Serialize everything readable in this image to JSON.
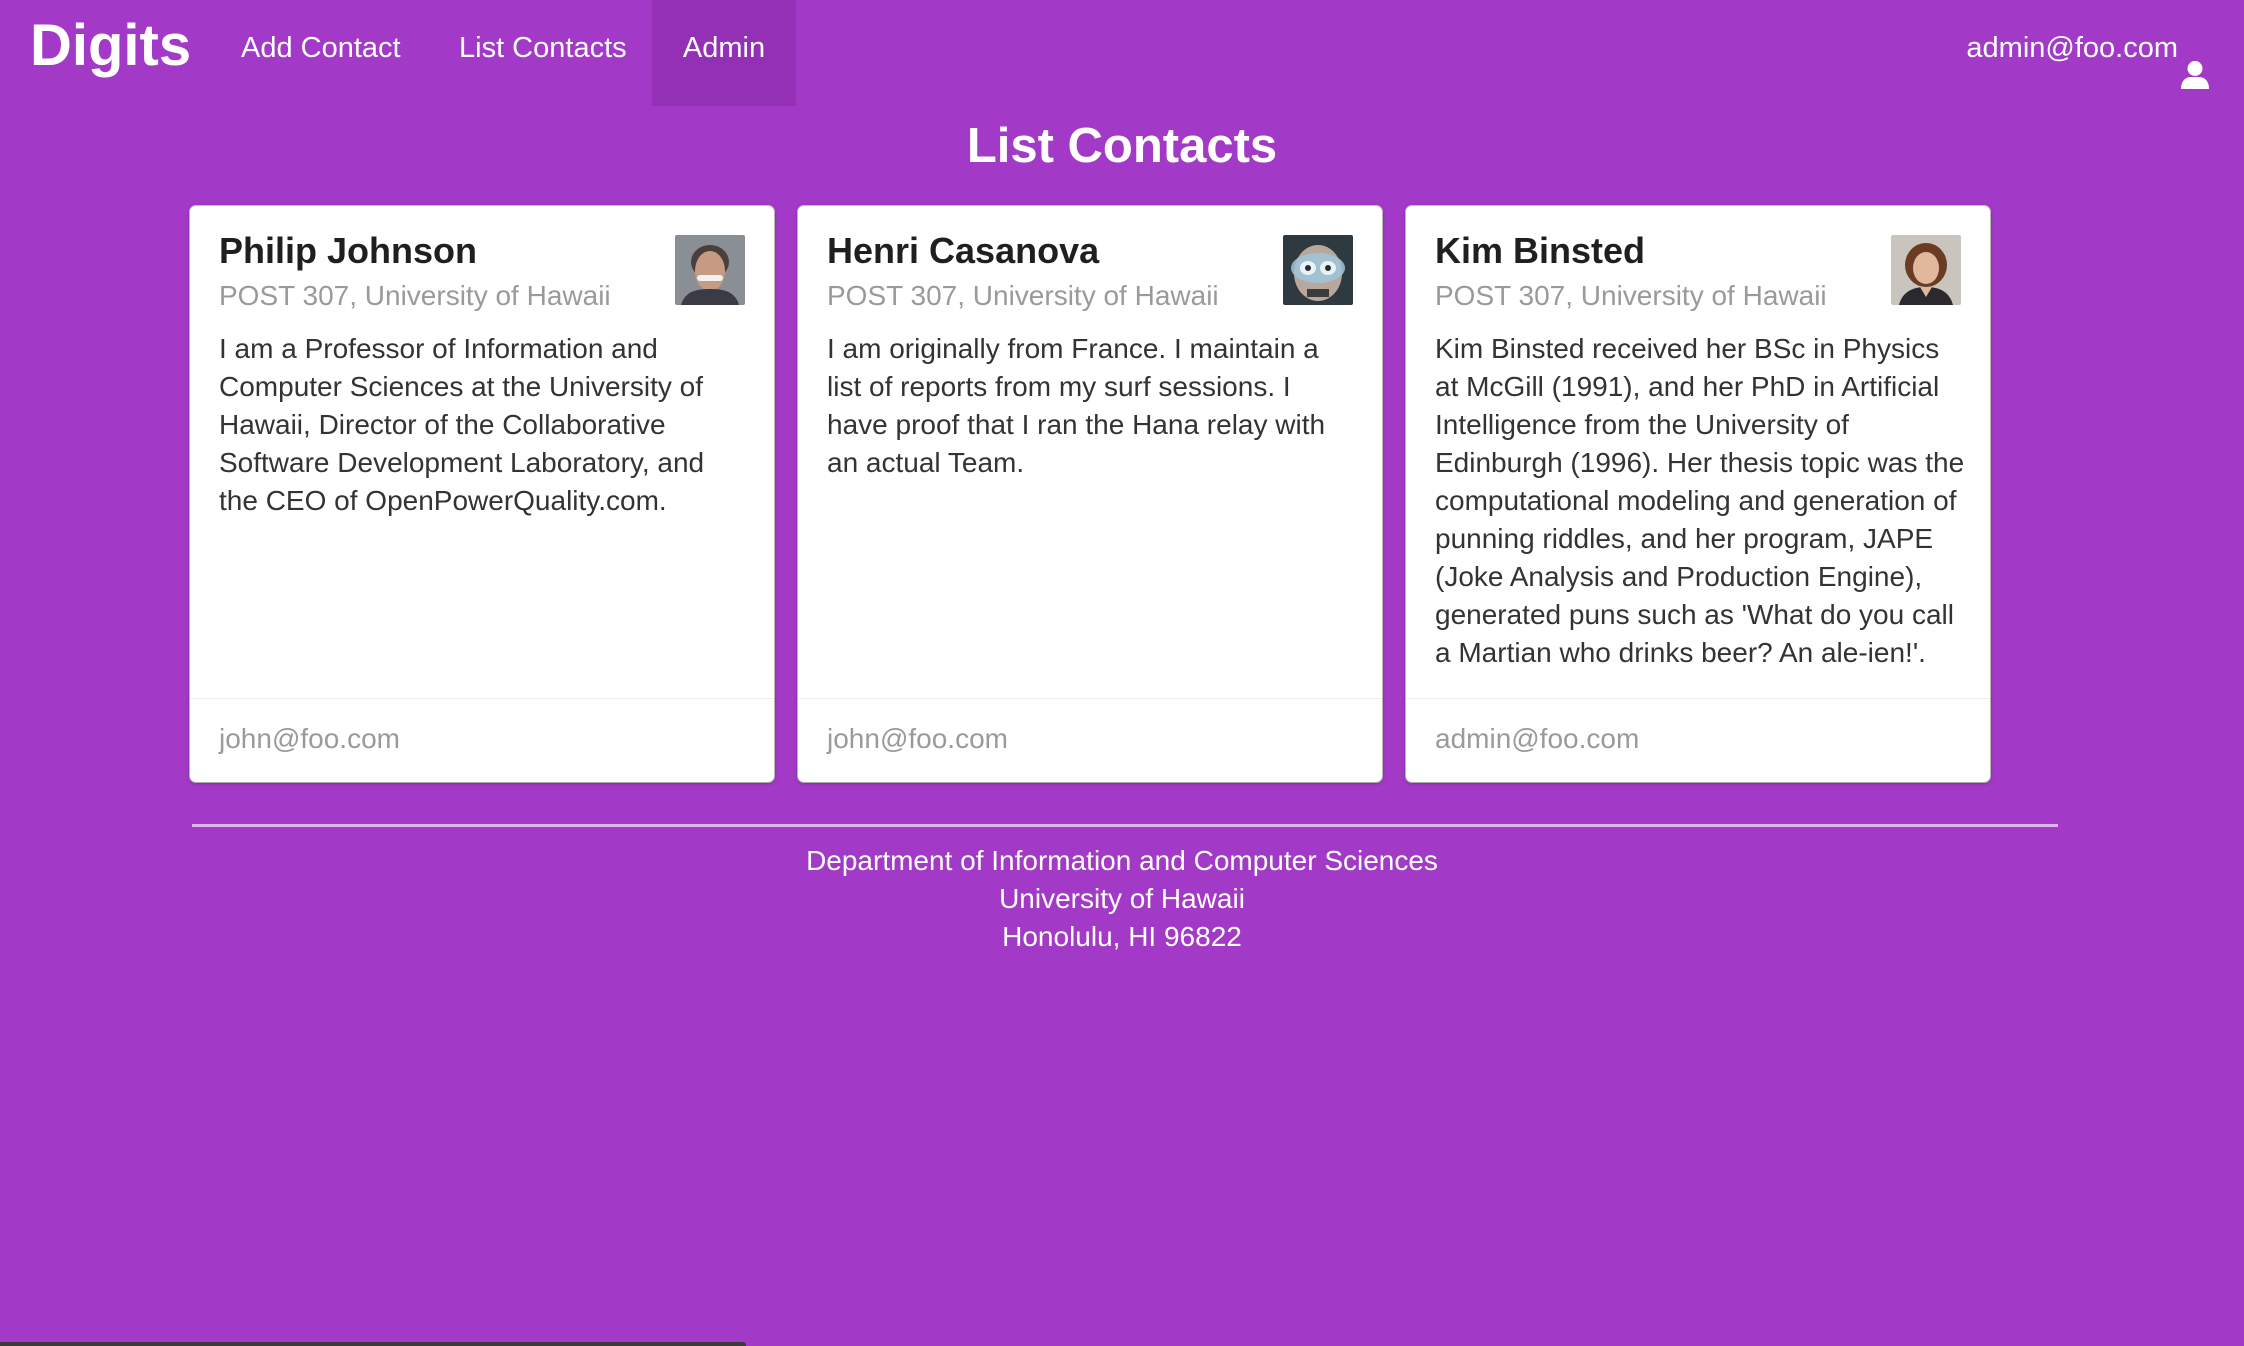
{
  "navbar": {
    "brand": "Digits",
    "links": {
      "add_contact": "Add Contact",
      "list_contacts": "List Contacts",
      "admin": "Admin"
    },
    "user_email": "admin@foo.com",
    "user_icon": "user-icon"
  },
  "page": {
    "title": "List Contacts"
  },
  "contacts": [
    {
      "name": "Philip Johnson",
      "address": "POST 307, University of Hawaii",
      "description": "I am a Professor of Information and Computer Sciences at the University of Hawaii, Director of the Collaborative Software Development Laboratory, and the CEO of OpenPowerQuality.com.",
      "owner": "john@foo.com"
    },
    {
      "name": "Henri Casanova",
      "address": "POST 307, University of Hawaii",
      "description": "I am originally from France. I maintain a list of reports from my surf sessions. I have proof that I ran the Hana relay with an actual Team.",
      "owner": "john@foo.com"
    },
    {
      "name": "Kim Binsted",
      "address": "POST 307, University of Hawaii",
      "description": "Kim Binsted received her BSc in Physics at McGill (1991), and her PhD in Artificial Intelligence from the University of Edinburgh (1996). Her thesis topic was the computational modeling and generation of punning riddles, and her program, JAPE (Joke Analysis and Production Engine), generated puns such as 'What do you call a Martian who drinks beer? An ale-ien!'.",
      "owner": "admin@foo.com"
    }
  ],
  "footer": {
    "line1": "Department of Information and Computer Sciences",
    "line2": "University of Hawaii",
    "line3": "Honolulu, HI 96822"
  },
  "colors": {
    "background": "#a33ac7",
    "active_nav": "#9330b5",
    "card": "#ffffff"
  }
}
